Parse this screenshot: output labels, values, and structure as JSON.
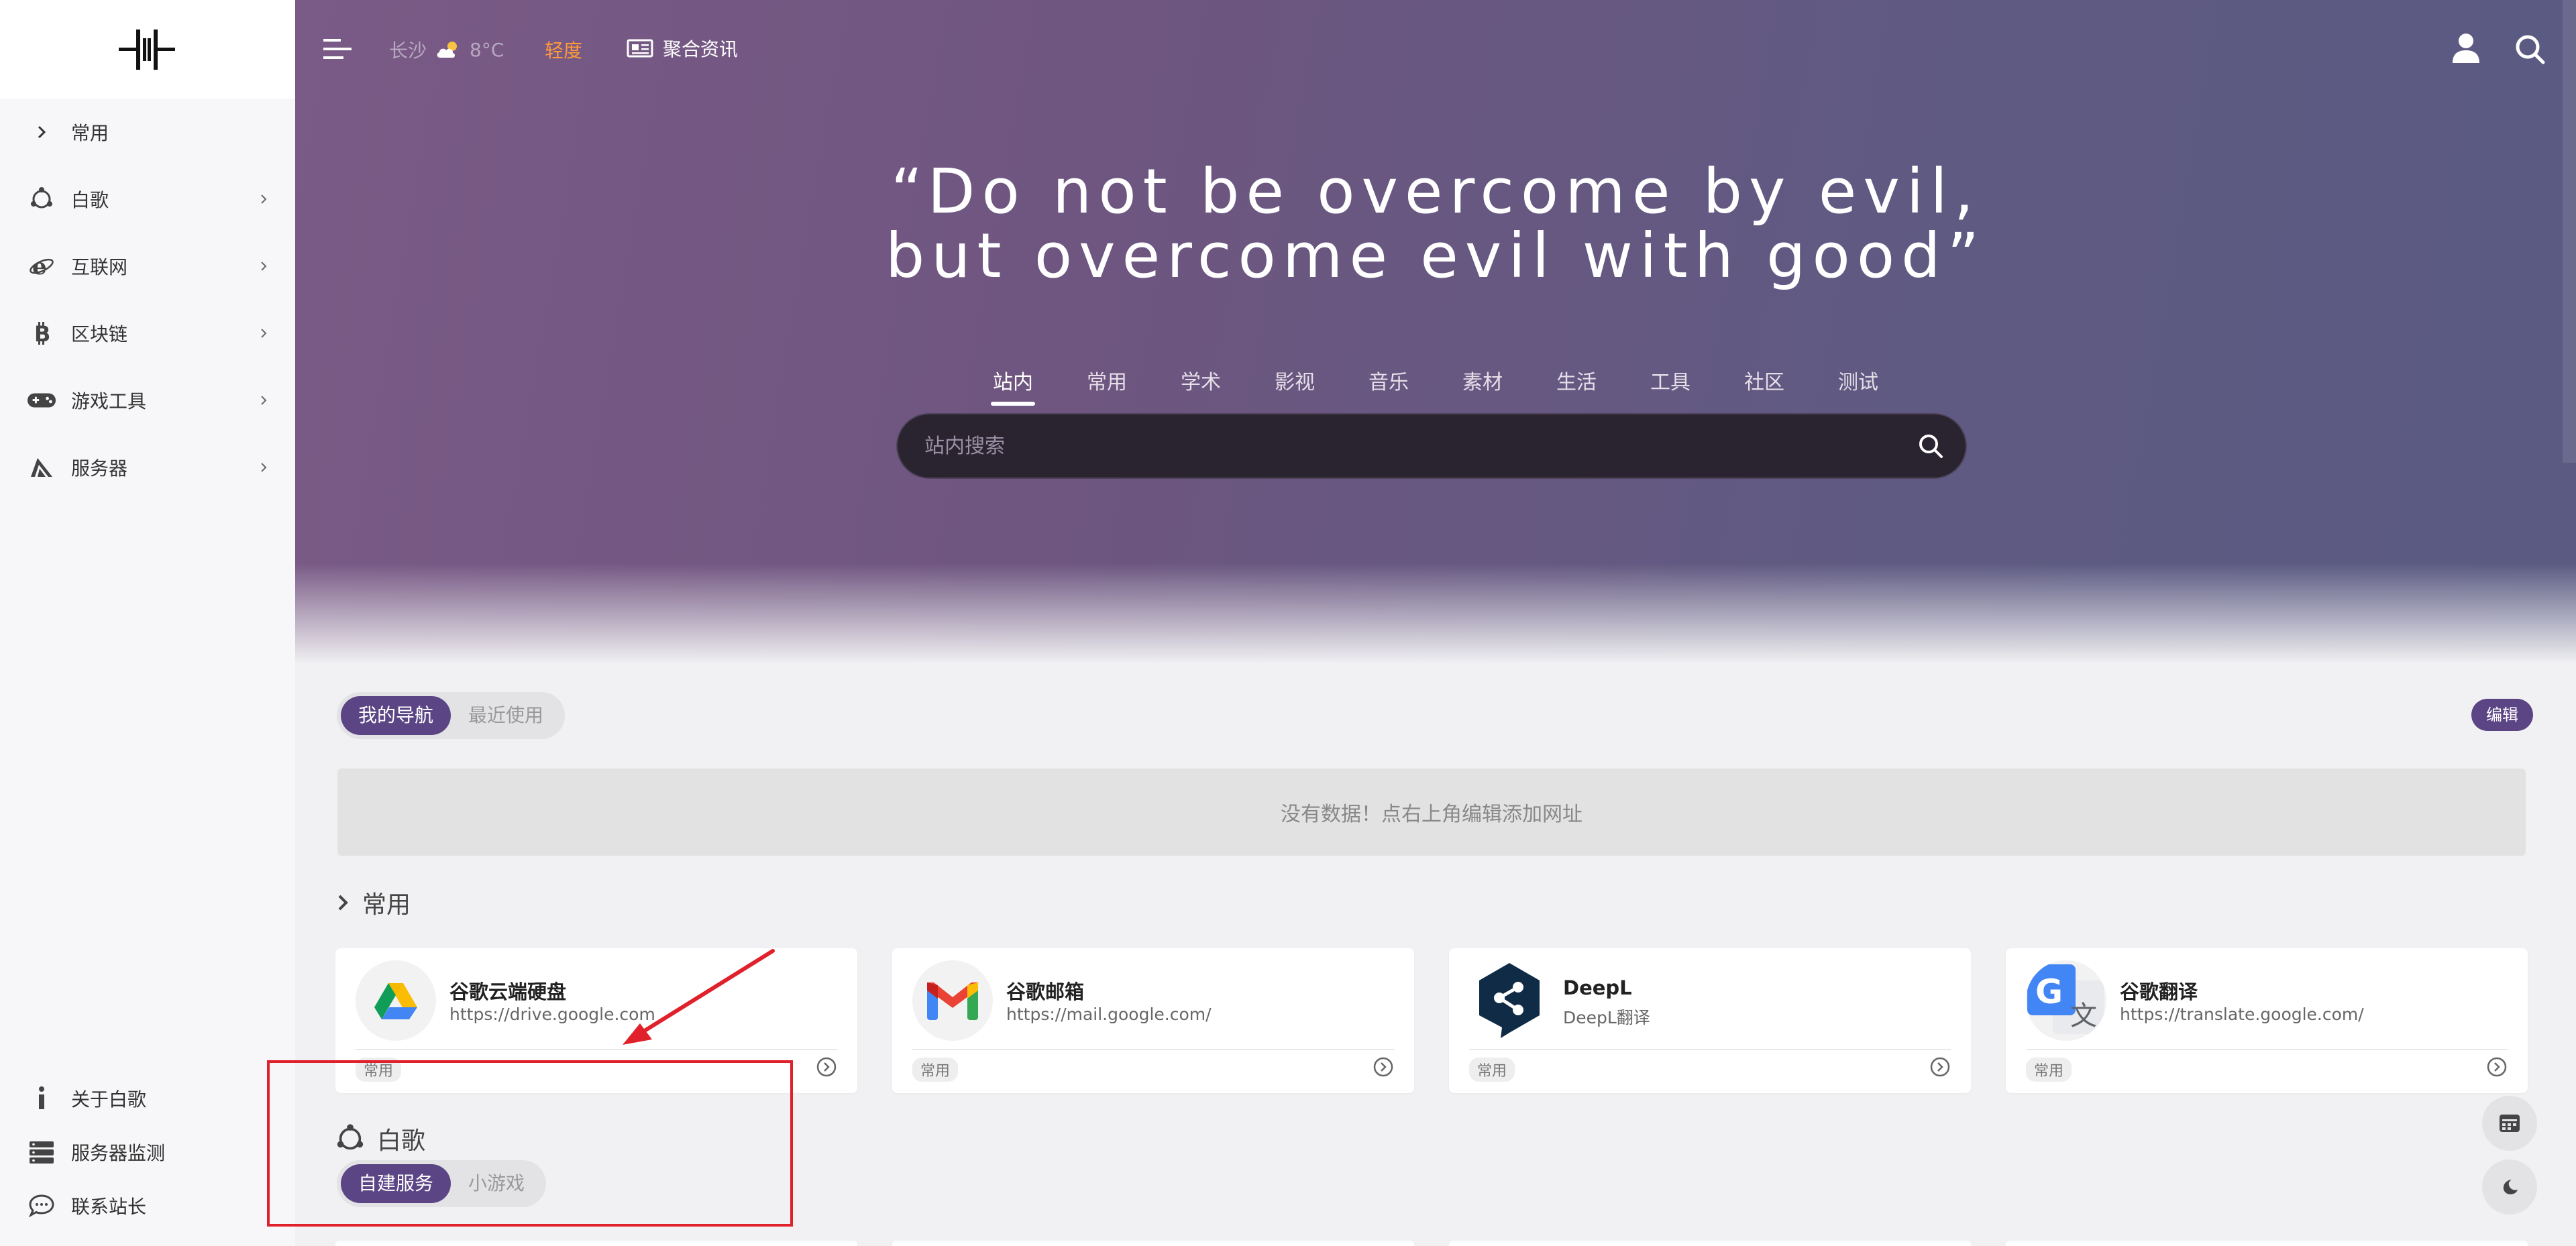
{
  "sidebar": {
    "items": [
      {
        "label": "常用",
        "icon": "chevron-right-icon"
      },
      {
        "label": "白歌",
        "icon": "ubuntu-icon"
      },
      {
        "label": "互联网",
        "icon": "ie-icon"
      },
      {
        "label": "区块链",
        "icon": "bitcoin-icon"
      },
      {
        "label": "游戏工具",
        "icon": "gamepad-icon"
      },
      {
        "label": "服务器",
        "icon": "server-wing-icon"
      }
    ],
    "bottom": [
      {
        "label": "关于白歌",
        "icon": "info-icon"
      },
      {
        "label": "服务器监测",
        "icon": "server-rack-icon"
      },
      {
        "label": "联系站长",
        "icon": "chat-icon"
      }
    ]
  },
  "topbar": {
    "city": "长沙",
    "temperature": "8°C",
    "light_link": "轻度",
    "news_label": "聚合资讯"
  },
  "hero": {
    "quote_line1": "“Do not be overcome by evil,",
    "quote_line2": "but overcome evil with good”",
    "tabs": [
      "站内",
      "常用",
      "学术",
      "影视",
      "音乐",
      "素材",
      "生活",
      "工具",
      "社区",
      "测试"
    ],
    "active_tab": "站内",
    "search_placeholder": "站内搜索"
  },
  "content": {
    "nav_tabs": [
      "我的导航",
      "最近使用"
    ],
    "edit_label": "编辑",
    "empty_message": "没有数据！点右上角编辑添加网址",
    "section1_title": "常用",
    "cards": [
      {
        "name": "谷歌云端硬盘",
        "url": "https://drive.google.com",
        "tag": "常用"
      },
      {
        "name": "谷歌邮箱",
        "url": "https://mail.google.com/",
        "tag": "常用"
      },
      {
        "name": "DeepL",
        "url": "DeepL翻译",
        "tag": "常用"
      },
      {
        "name": "谷歌翻译",
        "url": "https://translate.google.com/",
        "tag": "常用"
      }
    ],
    "section2_title": "白歌",
    "section2_tabs": [
      "自建服务",
      "小游戏"
    ]
  },
  "colors": {
    "accent": "#5b4585",
    "hero_start": "#7a5a86",
    "hero_end": "#5a5a82",
    "light_link": "#ff9a3c",
    "annotation": "#e0202a"
  }
}
